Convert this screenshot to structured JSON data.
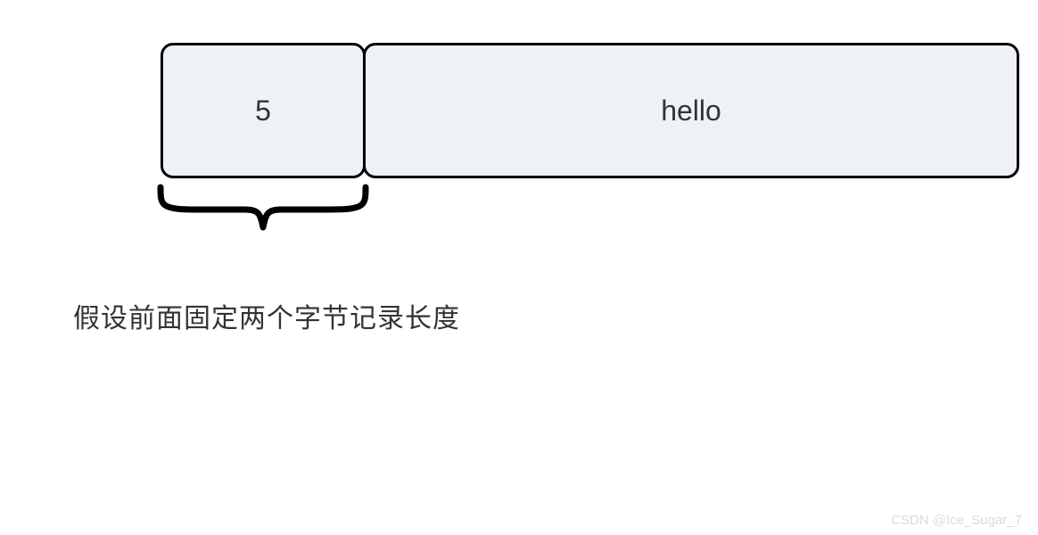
{
  "diagram": {
    "length_value": "5",
    "payload_value": "hello",
    "caption": "假设前面固定两个字节记录长度"
  },
  "watermark": "CSDN @Ice_Sugar_7"
}
